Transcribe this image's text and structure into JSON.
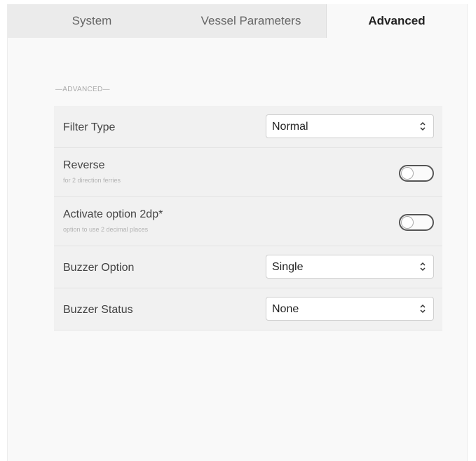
{
  "tabs": [
    {
      "label": "System",
      "active": false
    },
    {
      "label": "Vessel Parameters",
      "active": false
    },
    {
      "label": "Advanced",
      "active": true
    }
  ],
  "section": {
    "label": "—ADVANCED—"
  },
  "settings": {
    "filter_type": {
      "label": "Filter Type",
      "value": "Normal"
    },
    "reverse": {
      "label": "Reverse",
      "sublabel": "for 2 direction ferries",
      "enabled": false
    },
    "option_2dp": {
      "label": "Activate option 2dp*",
      "sublabel": "option to use 2 decimal places",
      "enabled": false
    },
    "buzzer_option": {
      "label": "Buzzer Option",
      "value": "Single"
    },
    "buzzer_status": {
      "label": "Buzzer Status",
      "value": "None"
    }
  },
  "icons": {
    "select_arrows": "chevron-up-down-icon"
  }
}
